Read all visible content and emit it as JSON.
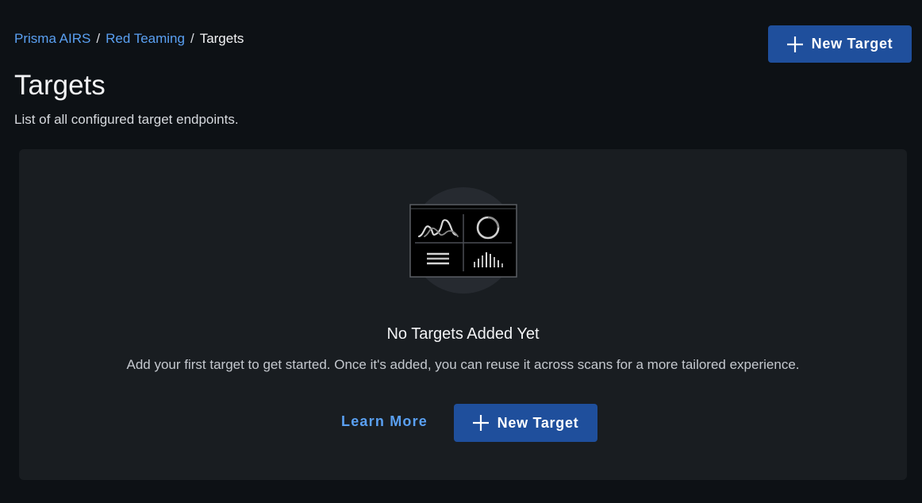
{
  "breadcrumb": {
    "items": [
      {
        "label": "Prisma AIRS",
        "link": true
      },
      {
        "label": "Red Teaming",
        "link": true
      },
      {
        "label": "Targets",
        "link": false
      }
    ],
    "separator": "/"
  },
  "header": {
    "title": "Targets",
    "subtitle": "List of all configured target endpoints.",
    "new_target_label": "New Target",
    "new_target_icon": "plus-icon"
  },
  "empty_state": {
    "illustration_icon": "dashboard-widgets-icon",
    "title": "No Targets Added Yet",
    "description": "Add your first target to get started. Once it's added, you can reuse it across scans for a more tailored experience.",
    "learn_more_label": "Learn More",
    "new_target_label": "New Target",
    "new_target_icon": "plus-icon"
  },
  "colors": {
    "background": "#0d1115",
    "panel": "#191d21",
    "primary_button": "#1f4f9c",
    "link": "#5aa0f2"
  }
}
